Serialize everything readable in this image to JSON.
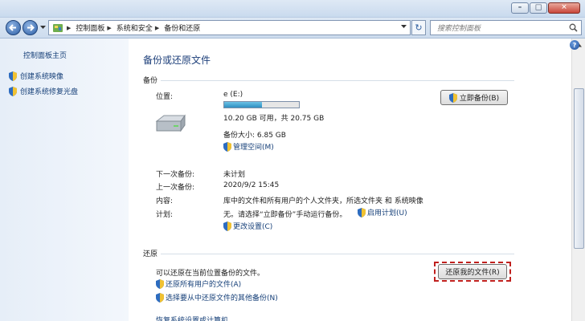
{
  "window": {
    "minimize_glyph": "–",
    "maximize_glyph": "□",
    "close_glyph": "✕"
  },
  "address_bar": {
    "breadcrumbs": [
      "控制面板",
      "系统和安全",
      "备份和还原"
    ],
    "search_placeholder": "搜索控制面板"
  },
  "sidebar": {
    "home": "控制面板主页",
    "items": [
      "创建系统映像",
      "创建系统修复光盘"
    ]
  },
  "main": {
    "title": "备份或还原文件",
    "backup": {
      "section": "备份",
      "location_label": "位置:",
      "drive_name": "e (E:)",
      "drive_used_fraction": 0.51,
      "free_space": "10.20 GB 可用，共 20.75 GB",
      "backup_size": "备份大小: 6.85 GB",
      "manage_space": "管理空间(M)",
      "backup_now_button": "立即备份(B)",
      "next_backup_label": "下一次备份:",
      "next_backup_value": "未计划",
      "last_backup_label": "上一次备份:",
      "last_backup_value": "2020/9/2 15:45",
      "contents_label": "内容:",
      "contents_value": "库中的文件和所有用户的个人文件夹，所选文件夹 和 系统映像",
      "schedule_label": "计划:",
      "schedule_value": "无。请选择“立即备份”手动运行备份。",
      "enable_schedule": "启用计划(U)",
      "change_settings": "更改设置(C)"
    },
    "restore": {
      "section": "还原",
      "description": "可以还原在当前位置备份的文件。",
      "restore_button": "还原我的文件(R)",
      "restore_all_users": "还原所有用户的文件(A)",
      "select_other_backup": "选择要从中还原文件的其他备份(N)",
      "partial_next_link": "恢复系统设置或计算机"
    }
  },
  "colors": {
    "link": "#153f78",
    "title": "#1d3f7a",
    "highlight_border": "#c0201e",
    "progress_fill": "#2f8fc1"
  }
}
